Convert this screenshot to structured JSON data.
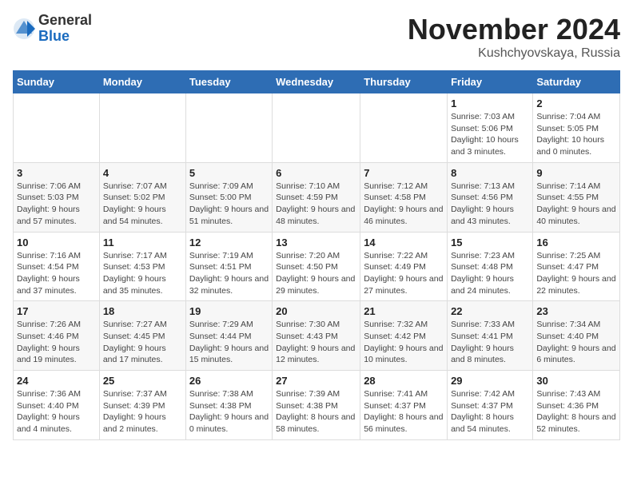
{
  "logo": {
    "general": "General",
    "blue": "Blue"
  },
  "title": "November 2024",
  "subtitle": "Kushchyovskaya, Russia",
  "weekdays": [
    "Sunday",
    "Monday",
    "Tuesday",
    "Wednesday",
    "Thursday",
    "Friday",
    "Saturday"
  ],
  "weeks": [
    [
      {
        "day": "",
        "info": ""
      },
      {
        "day": "",
        "info": ""
      },
      {
        "day": "",
        "info": ""
      },
      {
        "day": "",
        "info": ""
      },
      {
        "day": "",
        "info": ""
      },
      {
        "day": "1",
        "info": "Sunrise: 7:03 AM\nSunset: 5:06 PM\nDaylight: 10 hours and 3 minutes."
      },
      {
        "day": "2",
        "info": "Sunrise: 7:04 AM\nSunset: 5:05 PM\nDaylight: 10 hours and 0 minutes."
      }
    ],
    [
      {
        "day": "3",
        "info": "Sunrise: 7:06 AM\nSunset: 5:03 PM\nDaylight: 9 hours and 57 minutes."
      },
      {
        "day": "4",
        "info": "Sunrise: 7:07 AM\nSunset: 5:02 PM\nDaylight: 9 hours and 54 minutes."
      },
      {
        "day": "5",
        "info": "Sunrise: 7:09 AM\nSunset: 5:00 PM\nDaylight: 9 hours and 51 minutes."
      },
      {
        "day": "6",
        "info": "Sunrise: 7:10 AM\nSunset: 4:59 PM\nDaylight: 9 hours and 48 minutes."
      },
      {
        "day": "7",
        "info": "Sunrise: 7:12 AM\nSunset: 4:58 PM\nDaylight: 9 hours and 46 minutes."
      },
      {
        "day": "8",
        "info": "Sunrise: 7:13 AM\nSunset: 4:56 PM\nDaylight: 9 hours and 43 minutes."
      },
      {
        "day": "9",
        "info": "Sunrise: 7:14 AM\nSunset: 4:55 PM\nDaylight: 9 hours and 40 minutes."
      }
    ],
    [
      {
        "day": "10",
        "info": "Sunrise: 7:16 AM\nSunset: 4:54 PM\nDaylight: 9 hours and 37 minutes."
      },
      {
        "day": "11",
        "info": "Sunrise: 7:17 AM\nSunset: 4:53 PM\nDaylight: 9 hours and 35 minutes."
      },
      {
        "day": "12",
        "info": "Sunrise: 7:19 AM\nSunset: 4:51 PM\nDaylight: 9 hours and 32 minutes."
      },
      {
        "day": "13",
        "info": "Sunrise: 7:20 AM\nSunset: 4:50 PM\nDaylight: 9 hours and 29 minutes."
      },
      {
        "day": "14",
        "info": "Sunrise: 7:22 AM\nSunset: 4:49 PM\nDaylight: 9 hours and 27 minutes."
      },
      {
        "day": "15",
        "info": "Sunrise: 7:23 AM\nSunset: 4:48 PM\nDaylight: 9 hours and 24 minutes."
      },
      {
        "day": "16",
        "info": "Sunrise: 7:25 AM\nSunset: 4:47 PM\nDaylight: 9 hours and 22 minutes."
      }
    ],
    [
      {
        "day": "17",
        "info": "Sunrise: 7:26 AM\nSunset: 4:46 PM\nDaylight: 9 hours and 19 minutes."
      },
      {
        "day": "18",
        "info": "Sunrise: 7:27 AM\nSunset: 4:45 PM\nDaylight: 9 hours and 17 minutes."
      },
      {
        "day": "19",
        "info": "Sunrise: 7:29 AM\nSunset: 4:44 PM\nDaylight: 9 hours and 15 minutes."
      },
      {
        "day": "20",
        "info": "Sunrise: 7:30 AM\nSunset: 4:43 PM\nDaylight: 9 hours and 12 minutes."
      },
      {
        "day": "21",
        "info": "Sunrise: 7:32 AM\nSunset: 4:42 PM\nDaylight: 9 hours and 10 minutes."
      },
      {
        "day": "22",
        "info": "Sunrise: 7:33 AM\nSunset: 4:41 PM\nDaylight: 9 hours and 8 minutes."
      },
      {
        "day": "23",
        "info": "Sunrise: 7:34 AM\nSunset: 4:40 PM\nDaylight: 9 hours and 6 minutes."
      }
    ],
    [
      {
        "day": "24",
        "info": "Sunrise: 7:36 AM\nSunset: 4:40 PM\nDaylight: 9 hours and 4 minutes."
      },
      {
        "day": "25",
        "info": "Sunrise: 7:37 AM\nSunset: 4:39 PM\nDaylight: 9 hours and 2 minutes."
      },
      {
        "day": "26",
        "info": "Sunrise: 7:38 AM\nSunset: 4:38 PM\nDaylight: 9 hours and 0 minutes."
      },
      {
        "day": "27",
        "info": "Sunrise: 7:39 AM\nSunset: 4:38 PM\nDaylight: 8 hours and 58 minutes."
      },
      {
        "day": "28",
        "info": "Sunrise: 7:41 AM\nSunset: 4:37 PM\nDaylight: 8 hours and 56 minutes."
      },
      {
        "day": "29",
        "info": "Sunrise: 7:42 AM\nSunset: 4:37 PM\nDaylight: 8 hours and 54 minutes."
      },
      {
        "day": "30",
        "info": "Sunrise: 7:43 AM\nSunset: 4:36 PM\nDaylight: 8 hours and 52 minutes."
      }
    ]
  ]
}
